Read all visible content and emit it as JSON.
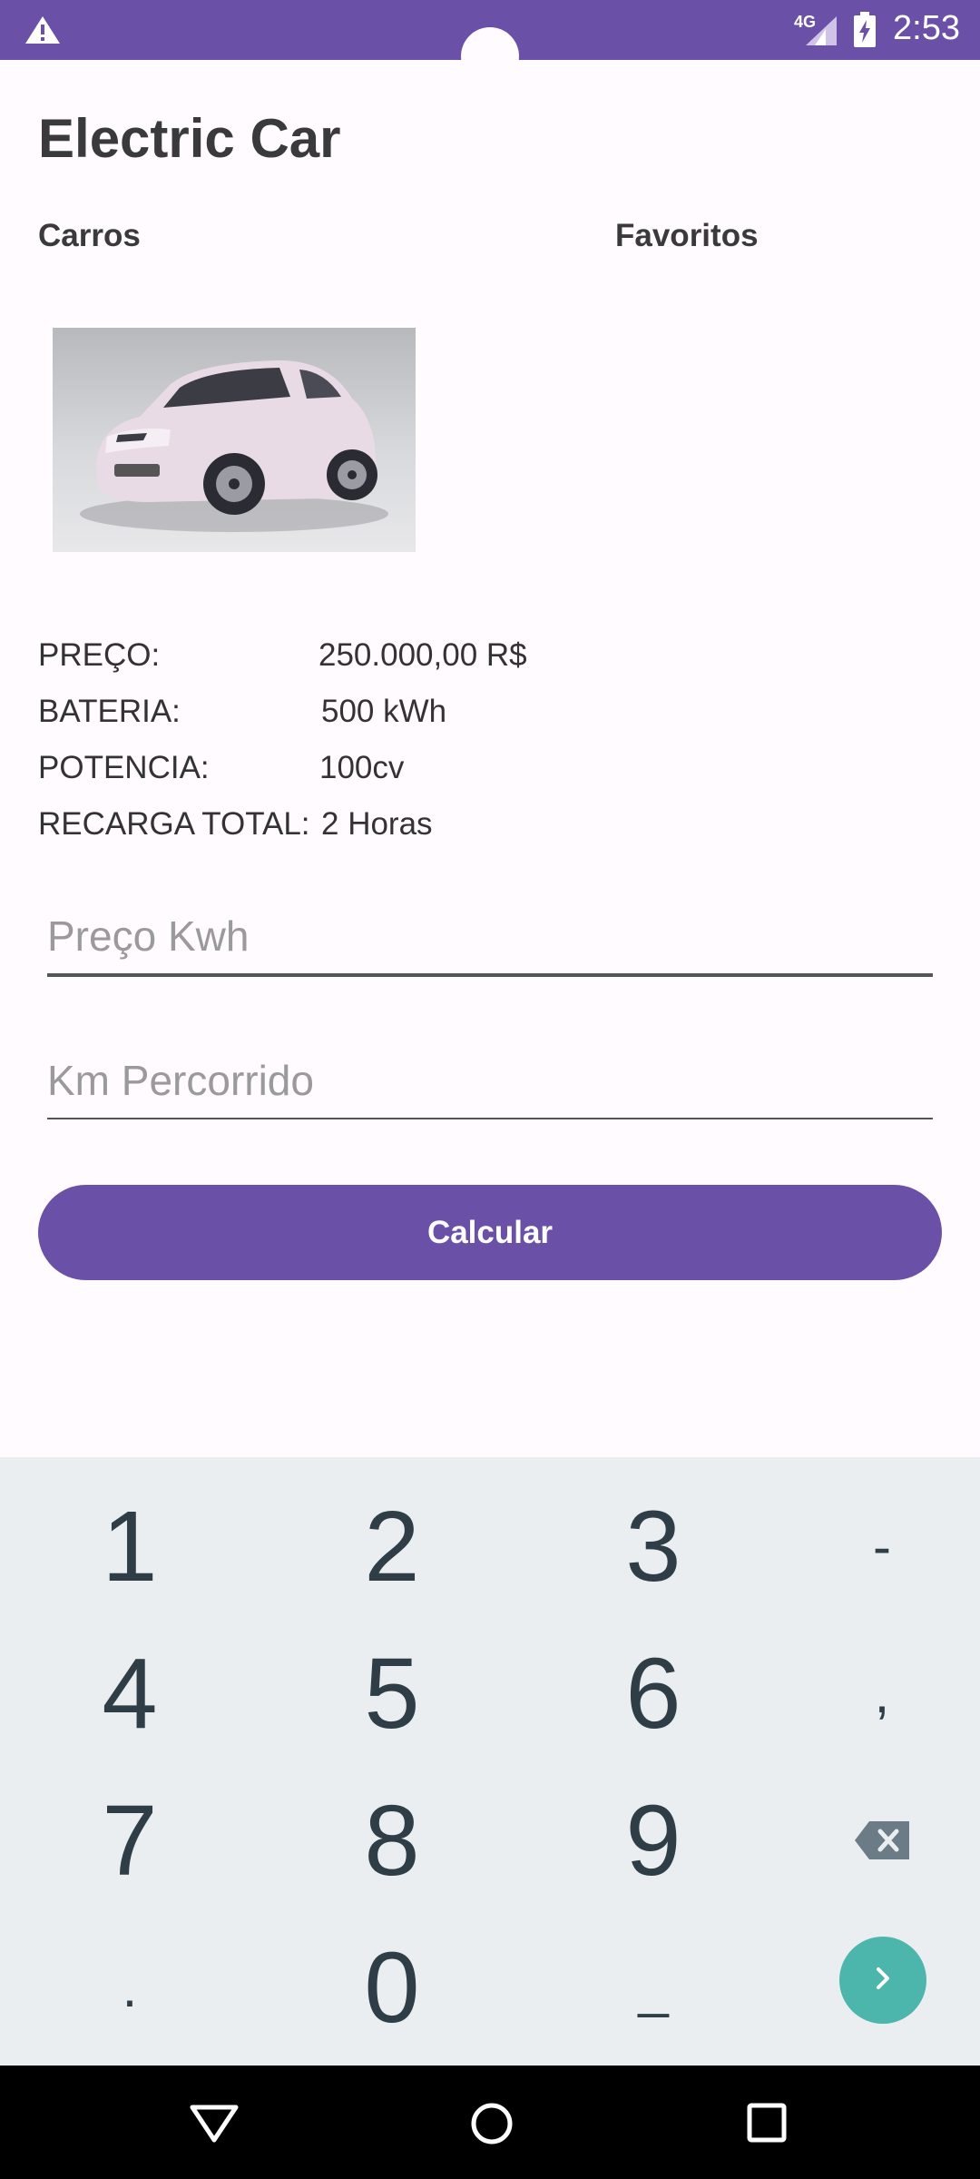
{
  "status_bar": {
    "network": "4G",
    "time": "2:53",
    "icons": [
      "warning-icon",
      "signal-icon",
      "battery-charging-icon"
    ]
  },
  "app": {
    "title": "Electric Car"
  },
  "tabs": [
    {
      "label": "Carros"
    },
    {
      "label": "Favoritos"
    }
  ],
  "car": {
    "specs": [
      {
        "label": "PREÇO:",
        "value": "250.000,00 R$"
      },
      {
        "label": "BATERIA:",
        "value": "500 kWh"
      },
      {
        "label": "POTENCIA:",
        "value": "100cv"
      },
      {
        "label": "RECARGA TOTAL:",
        "value": "2 Horas"
      }
    ]
  },
  "form": {
    "kwh_placeholder": "Preço Kwh",
    "km_placeholder": "Km Percorrido",
    "calculate_label": "Calcular"
  },
  "keypad": {
    "keys": [
      "1",
      "2",
      "3",
      "-",
      "4",
      "5",
      "6",
      ",",
      "7",
      "8",
      "9",
      ".",
      "0",
      "_"
    ],
    "enter_color": "#4db6ac"
  },
  "colors": {
    "primary": "#6a50a6",
    "background": "#fffbfe"
  }
}
